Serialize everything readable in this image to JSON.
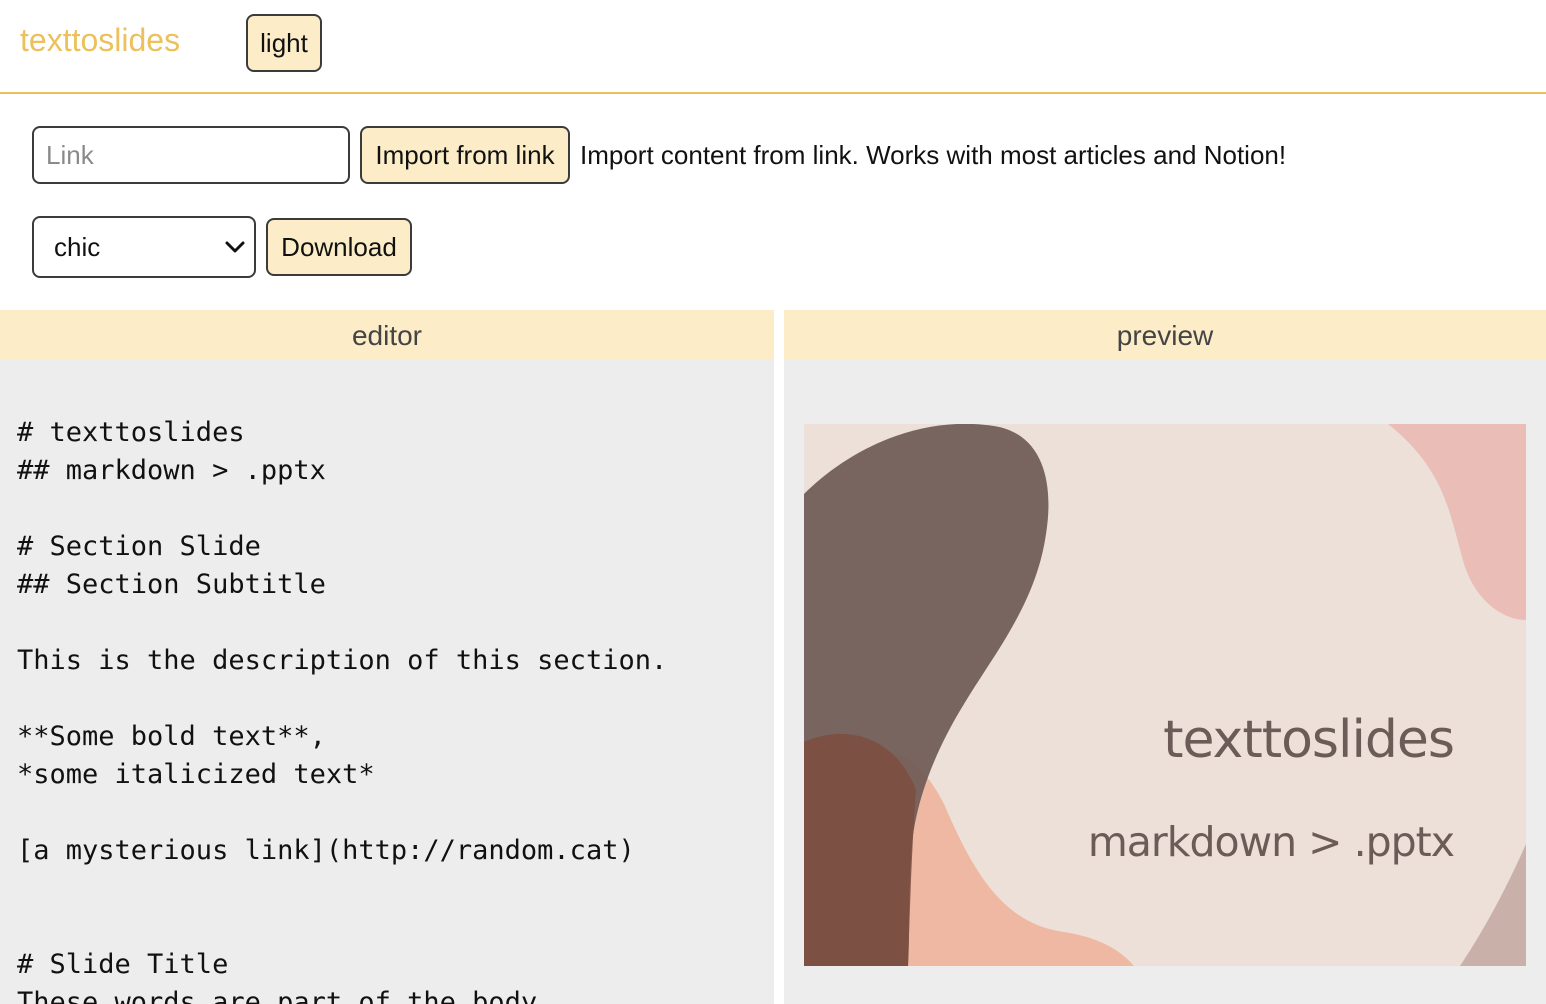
{
  "header": {
    "brand": "texttoslides",
    "theme_toggle_label": "light"
  },
  "import": {
    "link_placeholder": "Link",
    "link_value": "",
    "button_label": "Import from link",
    "help_text": "Import content from link. Works with most articles and Notion!"
  },
  "export": {
    "theme_selected": "chic",
    "download_label": "Download"
  },
  "editor": {
    "title": "editor",
    "content": "# texttoslides\n## markdown > .pptx\n\n# Section Slide\n## Section Subtitle\n\nThis is the description of this section.\n\n**Some bold text**,\n*some italicized text*\n\n[a mysterious link](http://random.cat)\n\n\n# Slide Title\nThese words are part of the body"
  },
  "preview": {
    "title": "preview",
    "slide_title": "texttoslides",
    "slide_subtitle": "markdown > .pptx"
  },
  "colors": {
    "accent": "#ecc15c",
    "button_bg": "#fcedc8",
    "panel_bg": "#ededed",
    "slide_bg": "#ede0d9",
    "slide_text": "#6b5c57",
    "blob_dark": "#6e5a55",
    "blob_brown": "#7c4d3f",
    "blob_peach": "#eeb49c",
    "blob_pink": "#eab6b0"
  }
}
